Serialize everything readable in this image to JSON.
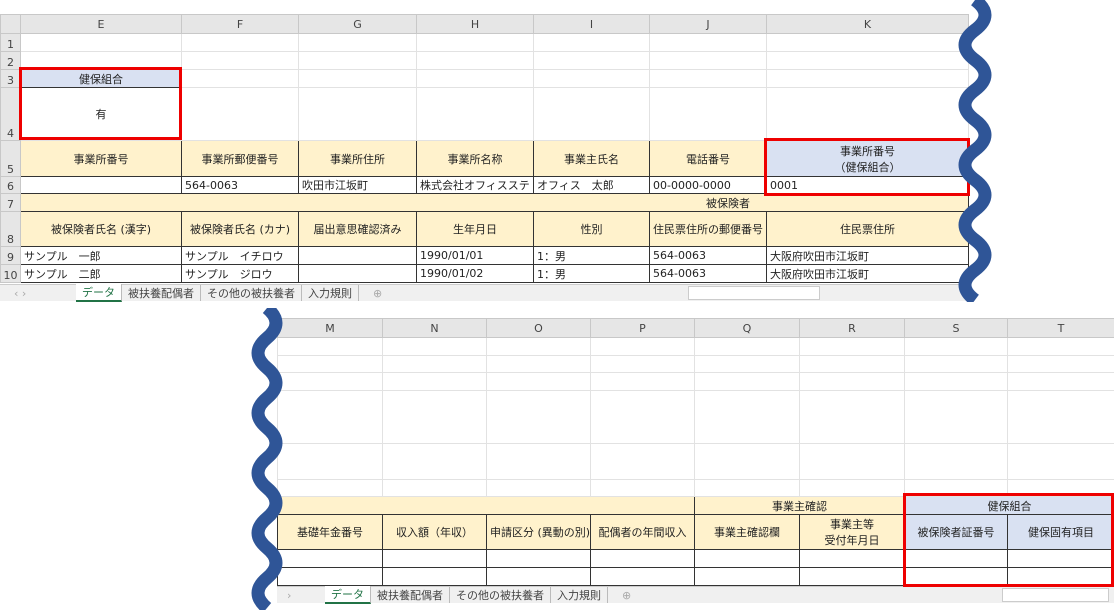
{
  "top": {
    "columns": [
      "E",
      "F",
      "G",
      "H",
      "I",
      "J",
      "K"
    ],
    "rows": [
      "1",
      "2",
      "3",
      "4",
      "5",
      "6",
      "7",
      "8",
      "9",
      "10"
    ],
    "e3": "健保組合",
    "e4": "有",
    "row5": [
      "事業所番号",
      "事業所郵便番号",
      "事業所住所",
      "事業所名称",
      "事業主氏名",
      "電話番号"
    ],
    "k5_line1": "事業所番号",
    "k5_line2": "（健保組合）",
    "row6": [
      "",
      "564-0063",
      "吹田市江坂町",
      "株式会社オフィスステ",
      "オフィス　太郎",
      "00-0000-0000",
      "0001"
    ],
    "row7": "被保険者",
    "row8": [
      "被保険者氏名 (漢字)",
      "被保険者氏名 (カナ)",
      "届出意思確認済み",
      "生年月日",
      "性別",
      "住民票住所の郵便番号",
      "住民票住所"
    ],
    "row9": [
      "サンプル　一郎",
      "サンプル　イチロウ",
      "",
      "1990/01/01",
      "1：男",
      "564-0063",
      "大阪府吹田市江坂町"
    ],
    "row10": [
      "サンプル　二郎",
      "サンプル　ジロウ",
      "",
      "1990/01/02",
      "1：男",
      "564-0063",
      "大阪府吹田市江坂町"
    ]
  },
  "bottom": {
    "columns": [
      "M",
      "N",
      "O",
      "P",
      "Q",
      "R",
      "S",
      "T"
    ],
    "row7_q": "事業主確認",
    "row7_s": "健保組合",
    "row8": [
      "基礎年金番号",
      "収入額（年収）",
      "申請区分 (異動の別)",
      "配偶者の年間収入",
      "事業主確認欄"
    ],
    "r8_line1": "事業主等",
    "r8_line2": "受付年月日",
    "s8": "被保険者証番号",
    "t8": "健保固有項目"
  },
  "tabs": [
    "データ",
    "被扶養配偶者",
    "その他の被扶養者",
    "入力規則"
  ],
  "colors": {
    "header_yellow": "#fff2cc",
    "header_blue": "#d9e1f2",
    "highlight": "#e00000",
    "wave": "#2f5597"
  }
}
